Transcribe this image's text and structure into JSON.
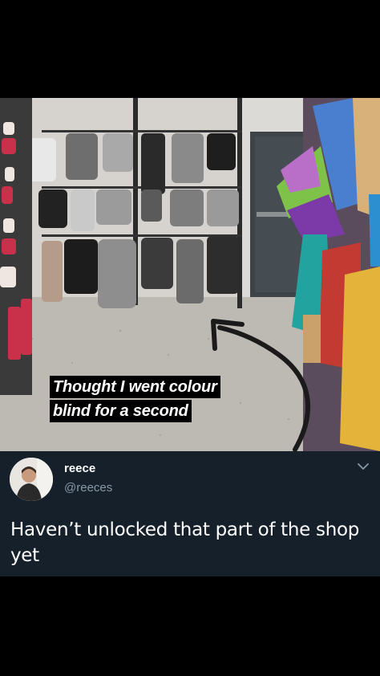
{
  "photo": {
    "caption_lines": [
      "Thought I went colour",
      "blind for a second"
    ]
  },
  "tweet": {
    "display_name": "reece",
    "handle": "@reeces",
    "text": "Haven’t unlocked that part of the shop yet",
    "menu_icon": "chevron-down-icon"
  },
  "colors": {
    "page_background": "#000000",
    "tweet_background": "#15202b",
    "handle_text": "#8899a6"
  }
}
